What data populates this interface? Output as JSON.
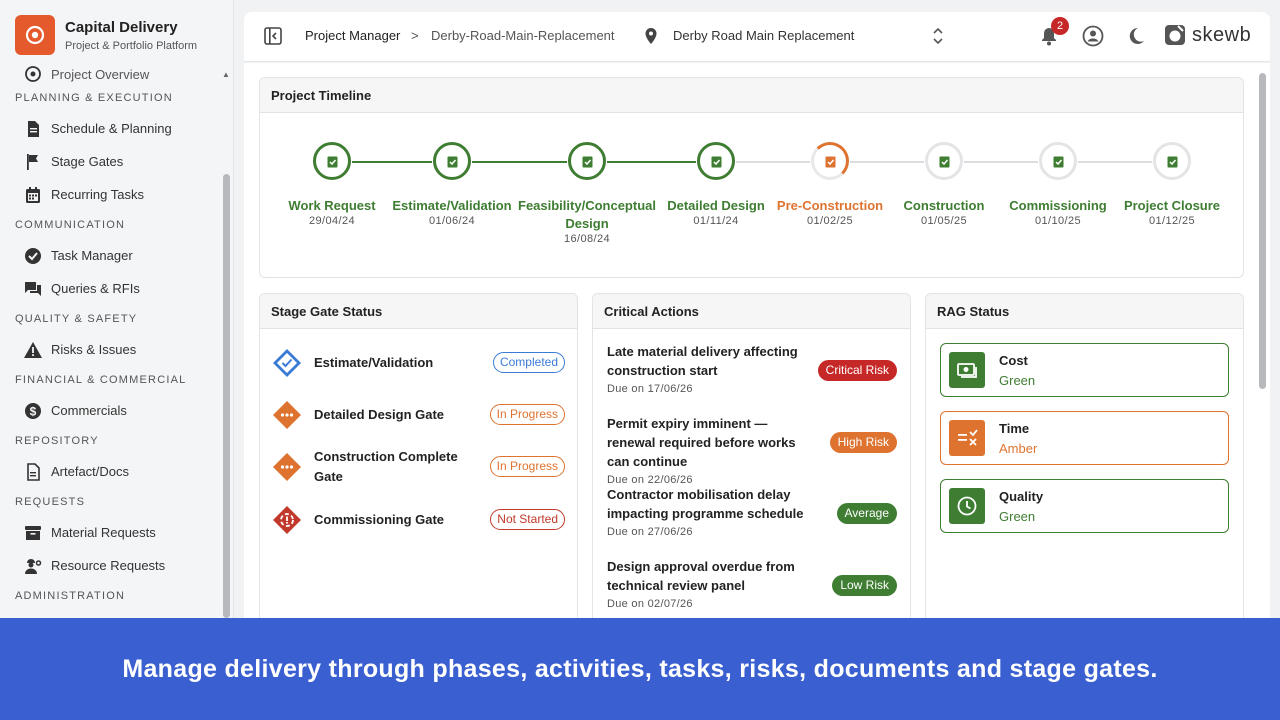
{
  "app": {
    "title": "Capital Delivery",
    "subtitle": "Project & Portfolio Platform"
  },
  "sidebar": {
    "partial_item": "Project Overview",
    "sections": [
      {
        "title": "PLANNING & EXECUTION",
        "items": [
          "Schedule & Planning",
          "Stage Gates",
          "Recurring Tasks"
        ]
      },
      {
        "title": "COMMUNICATION",
        "items": [
          "Task Manager",
          "Queries & RFIs"
        ]
      },
      {
        "title": "QUALITY & SAFETY",
        "items": [
          "Risks & Issues"
        ]
      },
      {
        "title": "FINANCIAL & COMMERCIAL",
        "items": [
          "Commercials"
        ]
      },
      {
        "title": "REPOSITORY",
        "items": [
          "Artefact/Docs"
        ]
      },
      {
        "title": "REQUESTS",
        "items": [
          "Material Requests",
          "Resource Requests"
        ]
      },
      {
        "title": "ADMINISTRATION",
        "items": []
      }
    ]
  },
  "topbar": {
    "breadcrumb_root": "Project Manager",
    "breadcrumb_sep": ">",
    "breadcrumb_current": "Derby-Road-Main-Replacement",
    "project_selected": "Derby Road Main Replacement",
    "notification_count": "2",
    "brand": "skewb"
  },
  "timeline": {
    "title": "Project Timeline",
    "stages": [
      {
        "label": "Work Request",
        "date": "29/04/24",
        "status": "complete"
      },
      {
        "label": "Estimate/Validation",
        "date": "01/06/24",
        "status": "complete"
      },
      {
        "label": "Feasibility/Conceptual Design",
        "date": "16/08/24",
        "status": "complete"
      },
      {
        "label": "Detailed Design",
        "date": "01/11/24",
        "status": "complete"
      },
      {
        "label": "Pre-Construction",
        "date": "01/02/25",
        "status": "current"
      },
      {
        "label": "Construction",
        "date": "01/05/25",
        "status": "pending"
      },
      {
        "label": "Commissioning",
        "date": "01/10/25",
        "status": "pending"
      },
      {
        "label": "Project Closure",
        "date": "01/12/25",
        "status": "pending"
      }
    ]
  },
  "stage_gate": {
    "title": "Stage Gate Status",
    "rows": [
      {
        "name": "Estimate/Validation",
        "status": "Completed"
      },
      {
        "name": "Detailed Design Gate",
        "status": "In Progress"
      },
      {
        "name": "Construction Complete Gate",
        "status": "In Progress"
      },
      {
        "name": "Commissioning Gate",
        "status": "Not Started"
      }
    ]
  },
  "critical_actions": {
    "title": "Critical Actions",
    "items": [
      {
        "title": "Late material delivery affecting construction start",
        "due": "Due on 17/06/26",
        "level": "Critical Risk"
      },
      {
        "title": "Permit expiry imminent — renewal required before works can continue",
        "due": "Due on 22/06/26",
        "level": "High Risk"
      },
      {
        "title": "Contractor mobilisation delay impacting programme schedule",
        "due": "Due on 27/06/26",
        "level": "Average"
      },
      {
        "title": "Design approval overdue from technical review panel",
        "due": "Due on 02/07/26",
        "level": "Low Risk"
      }
    ]
  },
  "rag": {
    "title": "RAG Status",
    "items": [
      {
        "name": "Cost",
        "value": "Green"
      },
      {
        "name": "Time",
        "value": "Amber"
      },
      {
        "name": "Quality",
        "value": "Green"
      }
    ]
  },
  "colors": {
    "green": "#3e7d32",
    "amber": "#de7330",
    "red": "#c0392b",
    "blue": "#3a7bd5",
    "brand": "#e45a2c",
    "banner": "#3a5fd0"
  },
  "banner": {
    "text": "Manage delivery through phases, activities, tasks, risks, documents and stage gates."
  }
}
